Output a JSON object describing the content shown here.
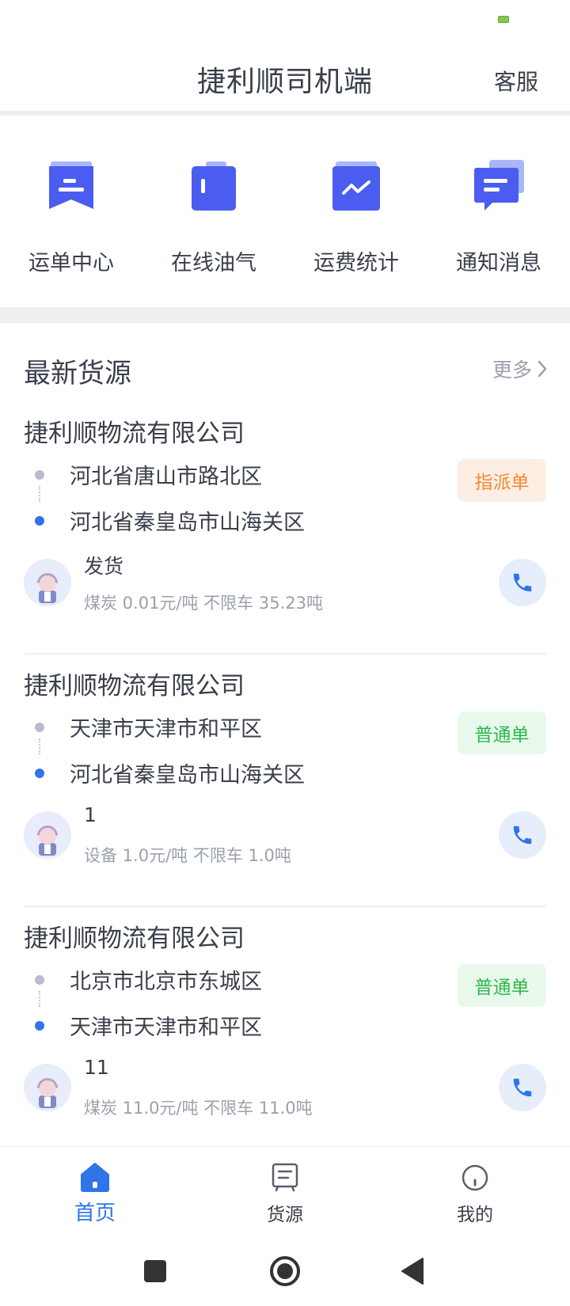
{
  "header": {
    "title": "捷利顺司机端",
    "service_label": "客服"
  },
  "quick_menu": [
    {
      "label": "运单中心",
      "icon": "waybill-icon"
    },
    {
      "label": "在线油气",
      "icon": "fuel-icon"
    },
    {
      "label": "运费统计",
      "icon": "stats-icon"
    },
    {
      "label": "通知消息",
      "icon": "message-icon"
    }
  ],
  "section": {
    "title": "最新货源",
    "more_label": "更多"
  },
  "cargo": [
    {
      "company": "捷利顺物流有限公司",
      "from": "河北省唐山市路北区",
      "to": "河北省秦皇岛市山海关区",
      "badge": "指派单",
      "shipper": "发货",
      "detail": "煤炭 0.01元/吨 不限车 35.23吨"
    },
    {
      "company": "捷利顺物流有限公司",
      "from": "天津市天津市和平区",
      "to": "河北省秦皇岛市山海关区",
      "badge": "普通单",
      "shipper": "1",
      "detail": "设备 1.0元/吨 不限车 1.0吨"
    },
    {
      "company": "捷利顺物流有限公司",
      "from": "北京市北京市东城区",
      "to": "天津市天津市和平区",
      "badge": "普通单",
      "shipper": "11",
      "detail": "煤炭 11.0元/吨 不限车 11.0吨"
    }
  ],
  "tabs": [
    {
      "label": "首页",
      "icon": "home-icon",
      "active": true
    },
    {
      "label": "货源",
      "icon": "cargo-icon",
      "active": false
    },
    {
      "label": "我的",
      "icon": "profile-icon",
      "active": false
    }
  ],
  "colors": {
    "accent": "#2f74e8",
    "icon_blue": "#4a5df0",
    "assign_badge": "#f08a33",
    "normal_badge": "#2db84c"
  }
}
